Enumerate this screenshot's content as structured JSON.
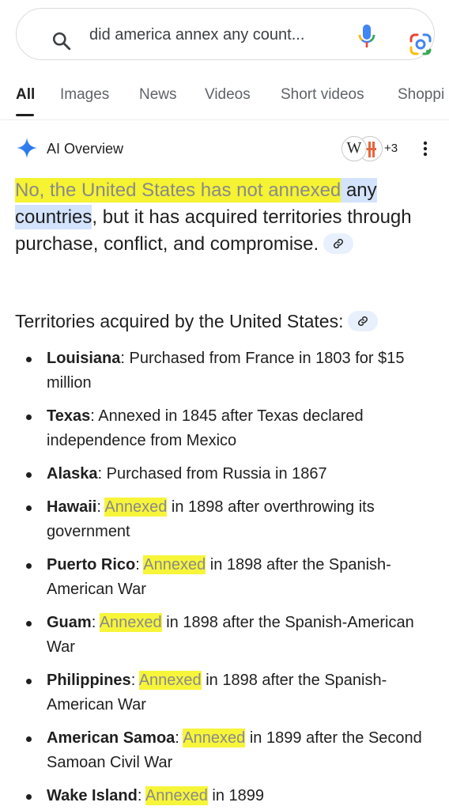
{
  "search": {
    "query": "did america annex any count..."
  },
  "tabs": [
    {
      "label": "All",
      "active": true
    },
    {
      "label": "Images",
      "active": false
    },
    {
      "label": "News",
      "active": false
    },
    {
      "label": "Videos",
      "active": false
    },
    {
      "label": "Short videos",
      "active": false
    },
    {
      "label": "Shoppi",
      "active": false
    }
  ],
  "ai_overview": {
    "title": "AI Overview",
    "source_badge_letter": "W",
    "more_sources": "+3",
    "answer_part1": "No, the United States has not annexed",
    "answer_part2": " any countries",
    "answer_part3": ", but it has acquired territories through purchase, conflict, and compromise.",
    "heading": "Territories acquired by the United States:"
  },
  "territories": [
    {
      "name": "Louisiana",
      "sep": ": ",
      "highlight": "",
      "text": "Purchased from France in 1803 for $15 million"
    },
    {
      "name": "Texas",
      "sep": ": ",
      "highlight": "",
      "text": "Annexed in 1845 after Texas declared independence from Mexico"
    },
    {
      "name": "Alaska",
      "sep": ": ",
      "highlight": "",
      "text": "Purchased from Russia in 1867"
    },
    {
      "name": "Hawaii",
      "sep": ": ",
      "highlight": "Annexed",
      "text": " in 1898 after overthrowing its government"
    },
    {
      "name": "Puerto Rico",
      "sep": ": ",
      "highlight": "Annexed",
      "text": " in 1898 after the Spanish-American War"
    },
    {
      "name": "Guam",
      "sep": ": ",
      "highlight": "Annexed",
      "text": " in 1898 after the Spanish-American War"
    },
    {
      "name": "Philippines",
      "sep": ": ",
      "highlight": "Annexed",
      "text": " in 1898 after the Spanish-American War"
    },
    {
      "name": "American Samoa",
      "sep": ": ",
      "highlight": "Annexed",
      "text": " in 1899 after the Second Samoan Civil War"
    },
    {
      "name": "Wake Island",
      "sep": ": ",
      "highlight": "Annexed",
      "text": " in 1899"
    }
  ],
  "colors": {
    "highlight_yellow": "#f5f332",
    "highlight_blue": "#d3e3fd",
    "google_blue": "#4285f4",
    "google_red": "#ea4335",
    "google_yellow": "#fbbc04",
    "google_green": "#34a853"
  },
  "icons": {
    "search": "search-icon",
    "mic": "mic-icon",
    "lens": "google-lens-icon",
    "sparkle": "ai-sparkle-icon",
    "menu": "more-vert-icon",
    "link": "link-icon"
  }
}
